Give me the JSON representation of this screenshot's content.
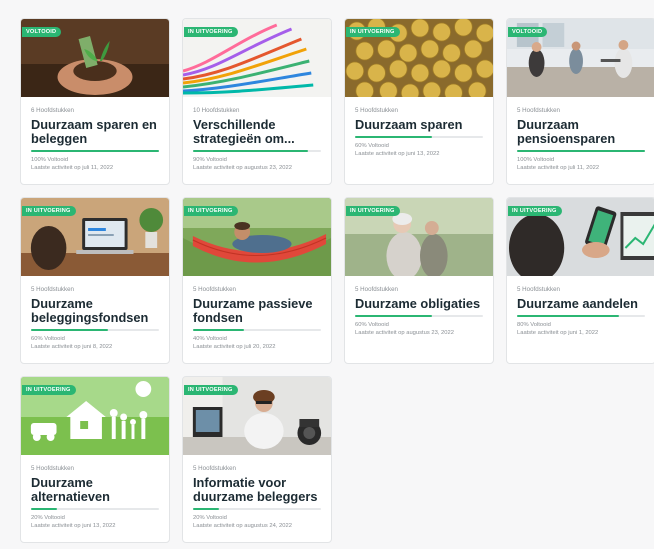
{
  "colors": {
    "accent": "#2bb673",
    "title": "#1c2b33",
    "muted": "#8a8f94"
  },
  "cards": [
    {
      "badge": "VOLTOOID",
      "chapters": "6 Hoofdstukken",
      "title": "Duurzaam sparen en beleggen",
      "progress": 100,
      "percent_text": "100% Voltooid",
      "activity": "Laatste activiteit op juli 11, 2022"
    },
    {
      "badge": "IN UITVOERING",
      "chapters": "10 Hoofdstukken",
      "title": "Verschillende strategieën om...",
      "progress": 90,
      "percent_text": "90% Voltooid",
      "activity": "Laatste activiteit op augustus 23, 2022"
    },
    {
      "badge": "IN UITVOERING",
      "chapters": "5 Hoofdstukken",
      "title": "Duurzaam sparen",
      "progress": 60,
      "percent_text": "60% Voltooid",
      "activity": "Laatste activiteit op juni 13, 2022"
    },
    {
      "badge": "VOLTOOID",
      "chapters": "5 Hoofdstukken",
      "title": "Duurzaam pensioensparen",
      "progress": 100,
      "percent_text": "100% Voltooid",
      "activity": "Laatste activiteit op juli 11, 2022"
    },
    {
      "badge": "IN UITVOERING",
      "chapters": "5 Hoofdstukken",
      "title": "Duurzame beleggingsfondsen",
      "progress": 60,
      "percent_text": "60% Voltooid",
      "activity": "Laatste activiteit op juni 8, 2022"
    },
    {
      "badge": "IN UITVOERING",
      "chapters": "5 Hoofdstukken",
      "title": "Duurzame passieve fondsen",
      "progress": 40,
      "percent_text": "40% Voltooid",
      "activity": "Laatste activiteit op juli 20, 2022"
    },
    {
      "badge": "IN UITVOERING",
      "chapters": "5 Hoofdstukken",
      "title": "Duurzame obligaties",
      "progress": 60,
      "percent_text": "60% Voltooid",
      "activity": "Laatste activiteit op augustus 23, 2022"
    },
    {
      "badge": "IN UITVOERING",
      "chapters": "5 Hoofdstukken",
      "title": "Duurzame aandelen",
      "progress": 80,
      "percent_text": "80% Voltooid",
      "activity": "Laatste activiteit op juni 1, 2022"
    },
    {
      "badge": "IN UITVOERING",
      "chapters": "5 Hoofdstukken",
      "title": "Duurzame alternatieven",
      "progress": 20,
      "percent_text": "20% Voltooid",
      "activity": "Laatste activiteit op juni 13, 2022"
    },
    {
      "badge": "IN UITVOERING",
      "chapters": "5 Hoofdstukken",
      "title": "Informatie voor duurzame beleggers",
      "progress": 20,
      "percent_text": "20% Voltooid",
      "activity": "Laatste activiteit op augustus 24, 2022"
    }
  ]
}
